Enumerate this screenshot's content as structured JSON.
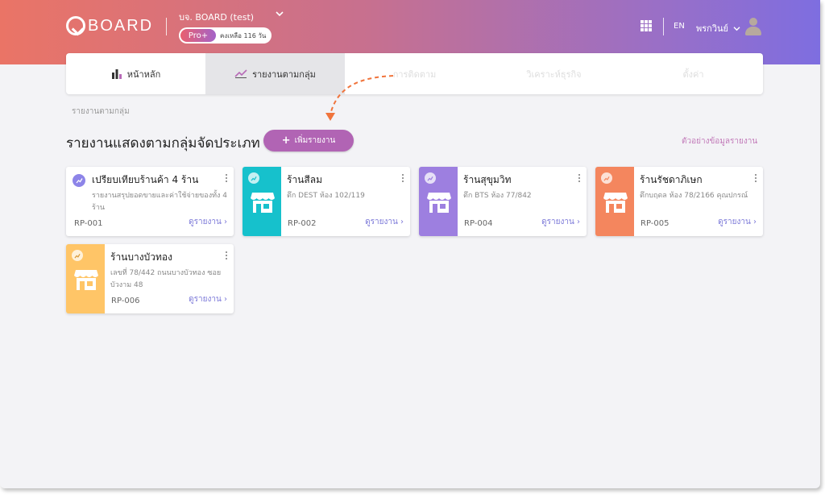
{
  "header": {
    "logo_text": "BOARD",
    "company": "บจ. BOARD (test)",
    "plan_badge": "Pro+",
    "plan_remaining": "คงเหลือ 116 วัน",
    "language": "EN",
    "user_name": "พรกวินย์"
  },
  "nav": {
    "tabs": [
      {
        "label": "หน้าหลัก"
      },
      {
        "label": "รายงานตามกลุ่ม"
      },
      {
        "label": "การติดตาม"
      },
      {
        "label": "วิเคราะห์ธุรกิจ"
      },
      {
        "label": "ตั้งค่า"
      }
    ]
  },
  "breadcrumb": "รายงานตามกลุ่ม",
  "page": {
    "title": "รายงานแสดงตามกลุ่มจัดประเภท",
    "add_button": "เพิ่มรายงาน",
    "sample_link": "ตัวอย่างข้อมูลรายงาน"
  },
  "cards": [
    {
      "title": "เปรียบเทียบร้านค้า 4 ร้าน",
      "subtitle": "รายงานสรุปยอดขายและค่าใช้จ่ายของทั้ง 4 ร้าน",
      "code": "RP-001",
      "link": "ดูรายงาน",
      "color": "#ffffff"
    },
    {
      "title": "ร้านสีลม",
      "subtitle": "ตึก DEST ห้อง 102/119",
      "code": "RP-002",
      "link": "ดูรายงาน",
      "color": "#16c1cc"
    },
    {
      "title": "ร้านสุขุมวิท",
      "subtitle": "ตึก BTS ห้อง 77/842",
      "code": "RP-004",
      "link": "ดูรายงาน",
      "color": "#9d7fe0"
    },
    {
      "title": "ร้านรัชดาภิเษก",
      "subtitle": "ตึกบฤดล ห้อง 78/2166 คุณปกรณ์",
      "code": "RP-005",
      "link": "ดูรายงาน",
      "color": "#f4865e"
    },
    {
      "title": "ร้านบางบัวทอง",
      "subtitle": "เลขที่ 78/442 ถนนบางบัวทอง ซอยบัวงาม 48",
      "code": "RP-006",
      "link": "ดูรายงาน",
      "color": "#ffc567"
    }
  ]
}
